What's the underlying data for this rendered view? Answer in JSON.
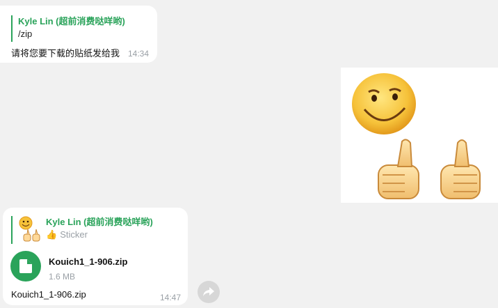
{
  "messages": [
    {
      "reply": {
        "author": "Kyle Lin (超前消费哒咩哟)",
        "text": "/zip"
      },
      "text": "请将您要下载的贴纸发给我",
      "time": "14:34"
    },
    {
      "reply": {
        "author": "Kyle Lin (超前消费哒咩哟)",
        "sub": "Sticker",
        "sub_emoji": "👍"
      },
      "file": {
        "name": "Kouich1_1-906.zip",
        "size": "1.6 MB",
        "icon": "file-icon"
      },
      "text": "Kouich1_1-906.zip",
      "time": "14:47"
    }
  ],
  "sticker": {
    "description_icon": "smiley-thumbs-up-sticker"
  },
  "forward": {
    "icon": "forward-arrow-icon"
  },
  "colors": {
    "accent": "#2aa35a",
    "background": "#f1f1f1",
    "bubble": "#ffffff",
    "muted": "#9aa0a6"
  }
}
